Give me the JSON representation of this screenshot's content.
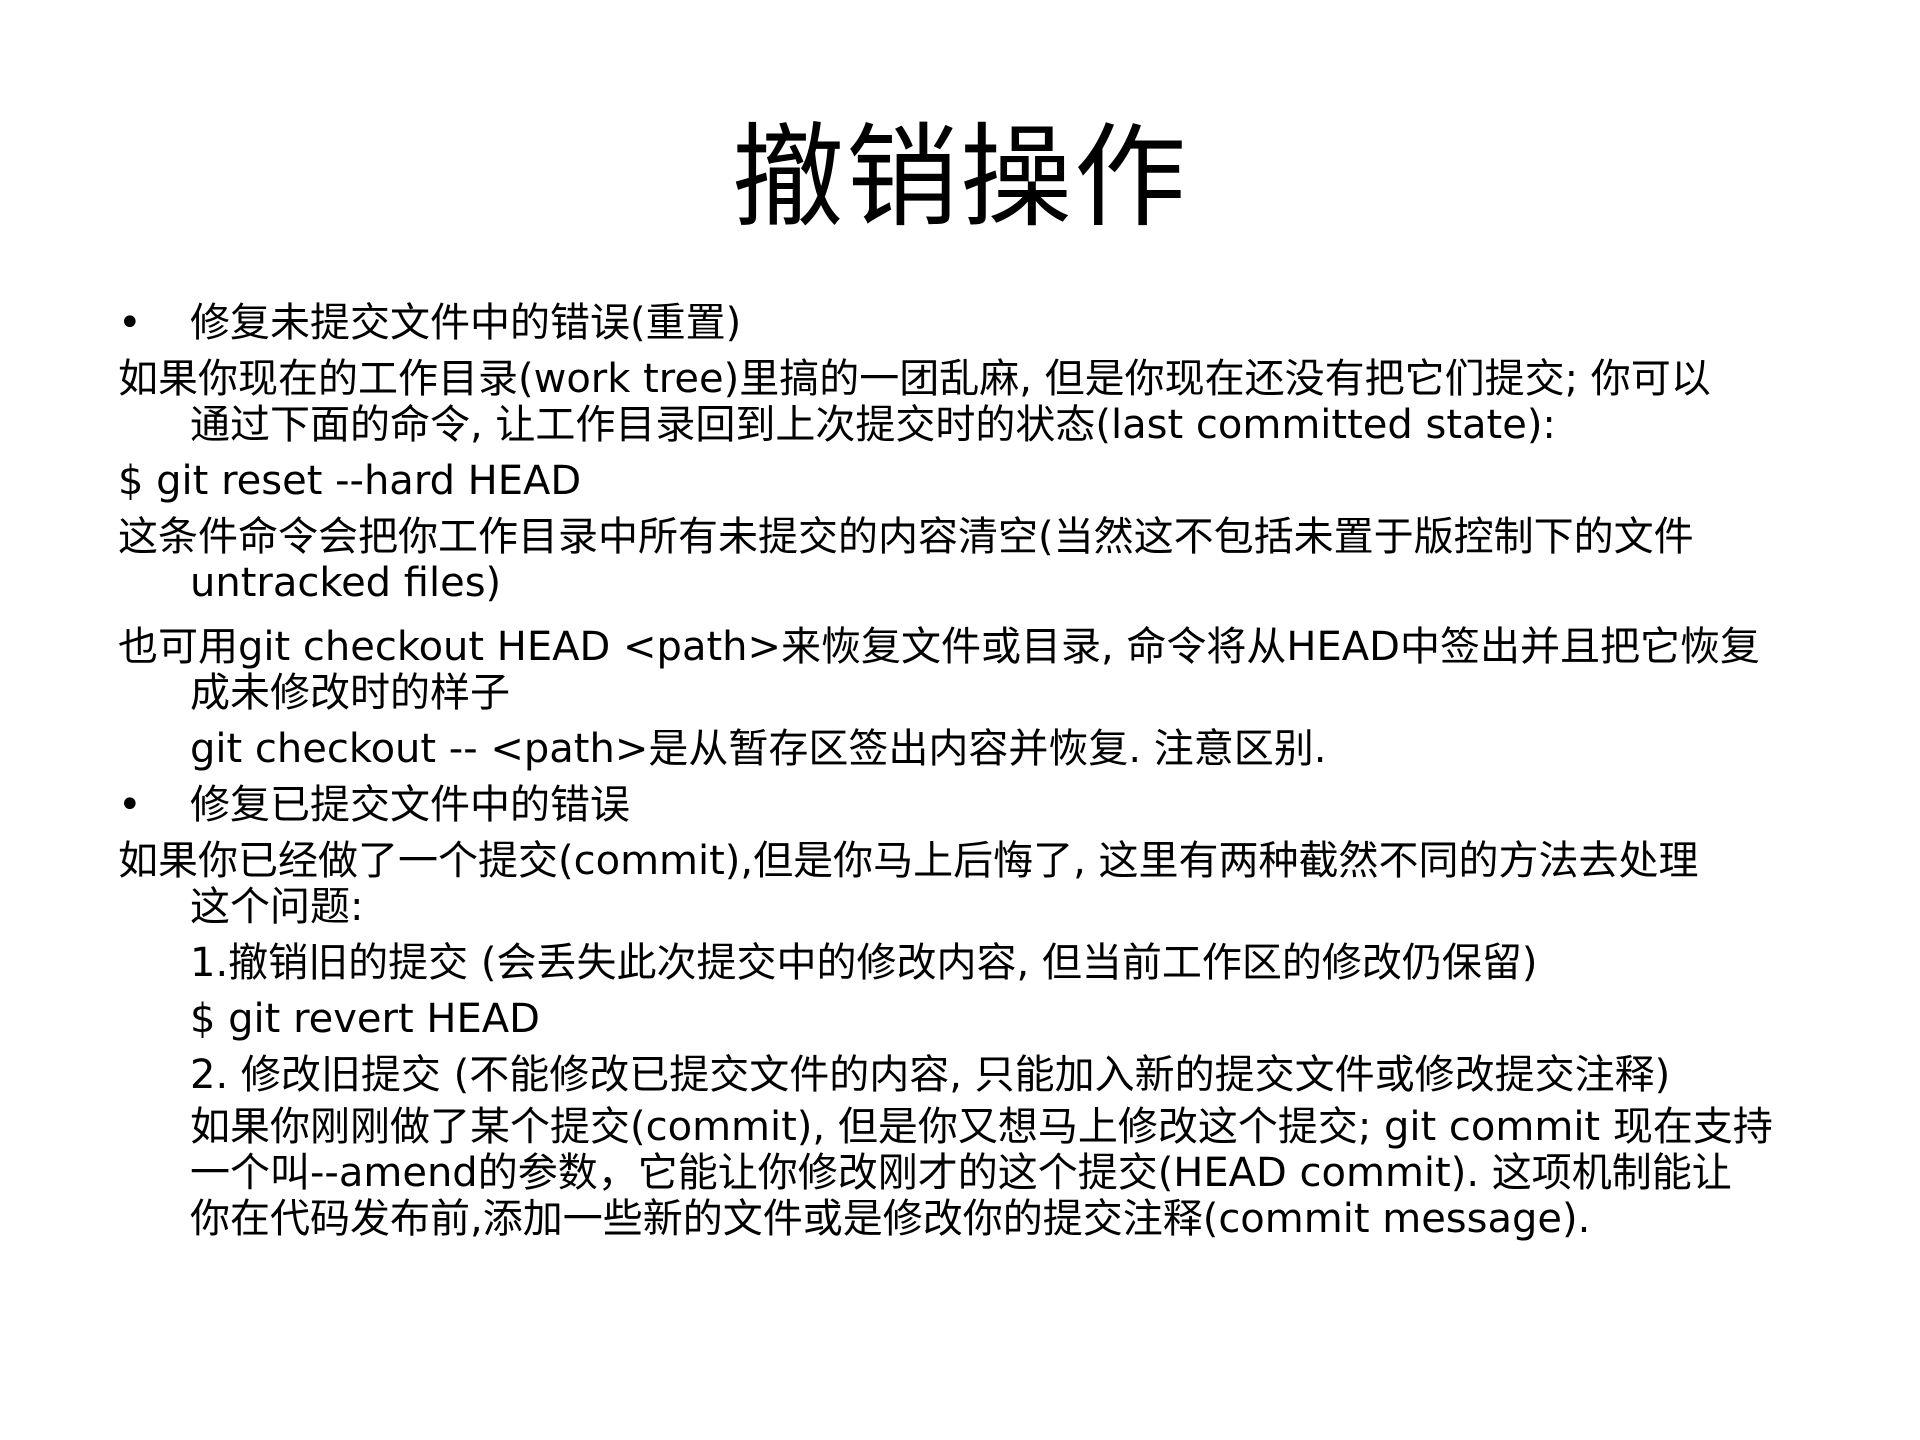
{
  "title": "撤销操作",
  "bullet_symbol": "•",
  "section1": {
    "heading": "修复未提交文件中的错误(重置)",
    "p1": [
      "如果你现在的工作目录(work tree)里搞的一团乱麻, 但是你现在还没有把它们提交; 你可以",
      "通过下面的命令, 让工作目录回到上次提交时的状态(last committed state):"
    ],
    "cmd1": "$ git reset --hard HEAD",
    "p2": [
      "这条件命令会把你工作目录中所有未提交的内容清空(当然这不包括未置于版控制下的文件",
      "untracked files)"
    ],
    "p3": [
      "也可用git checkout HEAD <path>来恢复文件或目录, 命令将从HEAD中签出并且把它恢复",
      "成未修改时的样子"
    ],
    "p4": "git checkout -- <path>是从暂存区签出内容并恢复. 注意区别."
  },
  "section2": {
    "heading": "修复已提交文件中的错误",
    "p1": [
      "如果你已经做了一个提交(commit),但是你马上后悔了, 这里有两种截然不同的方法去处理",
      "这个问题:"
    ],
    "opt1": "1.撤销旧的提交 (会丢失此次提交中的修改内容, 但当前工作区的修改仍保留)",
    "cmd": "$ git revert HEAD",
    "opt2": "2. 修改旧提交 (不能修改已提交文件的内容, 只能加入新的提交文件或修改提交注释)",
    "p2": [
      "如果你刚刚做了某个提交(commit), 但是你又想马上修改这个提交; git commit 现在支持",
      "一个叫--amend的参数，它能让你修改刚才的这个提交(HEAD commit). 这项机制能让",
      "你在代码发布前,添加一些新的文件或是修改你的提交注释(commit message)."
    ]
  }
}
